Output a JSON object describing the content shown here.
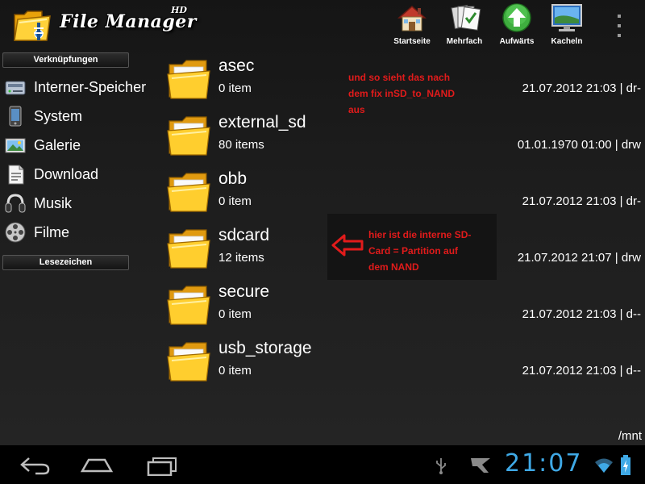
{
  "app": {
    "title": "File Manager",
    "badge": "HD"
  },
  "toolbar": {
    "buttons": [
      {
        "label": "Startseite",
        "icon": "home-icon"
      },
      {
        "label": "Mehrfach",
        "icon": "multi-select-icon"
      },
      {
        "label": "Aufwärts",
        "icon": "up-arrow-icon"
      },
      {
        "label": "Kacheln",
        "icon": "tiles-icon"
      }
    ],
    "overflow_icon": "overflow-menu-icon"
  },
  "sidebar": {
    "shortcuts_header": "Verknüpfungen",
    "items": [
      {
        "label": "Interner-Speicher",
        "icon": "internal-storage-icon"
      },
      {
        "label": "System",
        "icon": "system-icon"
      },
      {
        "label": "Galerie",
        "icon": "gallery-icon"
      },
      {
        "label": "Download",
        "icon": "download-icon"
      },
      {
        "label": "Musik",
        "icon": "music-icon"
      },
      {
        "label": "Filme",
        "icon": "film-icon"
      }
    ],
    "bookmarks_header": "Lesezeichen"
  },
  "files": [
    {
      "name": "asec",
      "count": "0 item",
      "meta": "21.07.2012 21:03 | dr-"
    },
    {
      "name": "external_sd",
      "count": "80 items",
      "meta": "01.01.1970 01:00 | drw"
    },
    {
      "name": "obb",
      "count": "0 item",
      "meta": "21.07.2012 21:03 | dr-"
    },
    {
      "name": "sdcard",
      "count": "12 items",
      "meta": "21.07.2012 21:07 | drw"
    },
    {
      "name": "secure",
      "count": "0 item",
      "meta": "21.07.2012 21:03 | d--"
    },
    {
      "name": "usb_storage",
      "count": "0 item",
      "meta": "21.07.2012 21:03 | d--"
    }
  ],
  "annotations": {
    "top": [
      "und so sieht das nach",
      "dem fix inSD_to_NAND",
      "aus"
    ],
    "box": [
      "hier ist die interne SD-",
      "Card = Partition auf",
      "dem NAND"
    ],
    "color": "#e11b1b"
  },
  "current_path": "/mnt",
  "statusbar": {
    "time": "21:07",
    "icons": [
      "back-icon",
      "home-nav-icon",
      "recent-apps-icon",
      "usb-icon",
      "notification-icon",
      "wifi-icon",
      "battery-icon"
    ],
    "clock_color": "#3fa9e6"
  }
}
